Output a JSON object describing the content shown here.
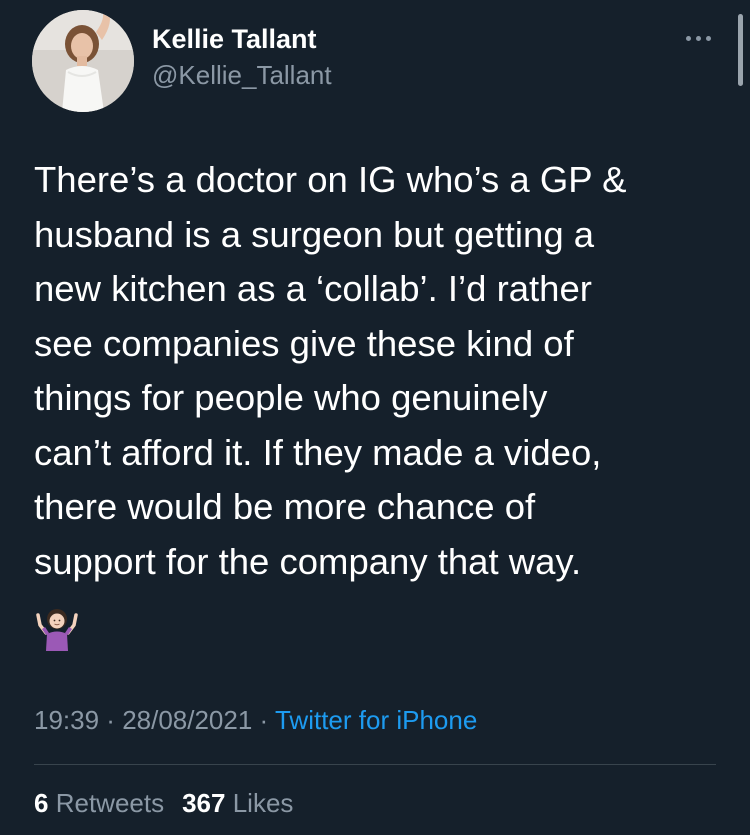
{
  "user": {
    "display_name": "Kellie Tallant",
    "handle": "@Kellie_Tallant"
  },
  "tweet": {
    "text": "There’s a doctor on IG who’s a GP &\nhusband is a surgeon but getting a\nnew kitchen as a ‘collab’. I’d rather\nsee companies give these kind of\nthings for people who genuinely\ncan’t afford it. If they made a video,\nthere would be more chance of\nsupport for the company that way.",
    "emoji": "person-shrugging-emoji"
  },
  "meta": {
    "time": "19:39",
    "separator": " · ",
    "date": "28/08/2021",
    "source": "Twitter for iPhone"
  },
  "stats": {
    "retweets_count": "6",
    "retweets_label": "Retweets",
    "likes_count": "367",
    "likes_label": "Likes"
  },
  "colors": {
    "background": "#15202b",
    "primary_text": "#ffffff",
    "secondary_text": "#8b98a5",
    "link": "#1d9bf0",
    "divider": "#38444d"
  },
  "icons": {
    "more": "more-horizontal-icon"
  }
}
